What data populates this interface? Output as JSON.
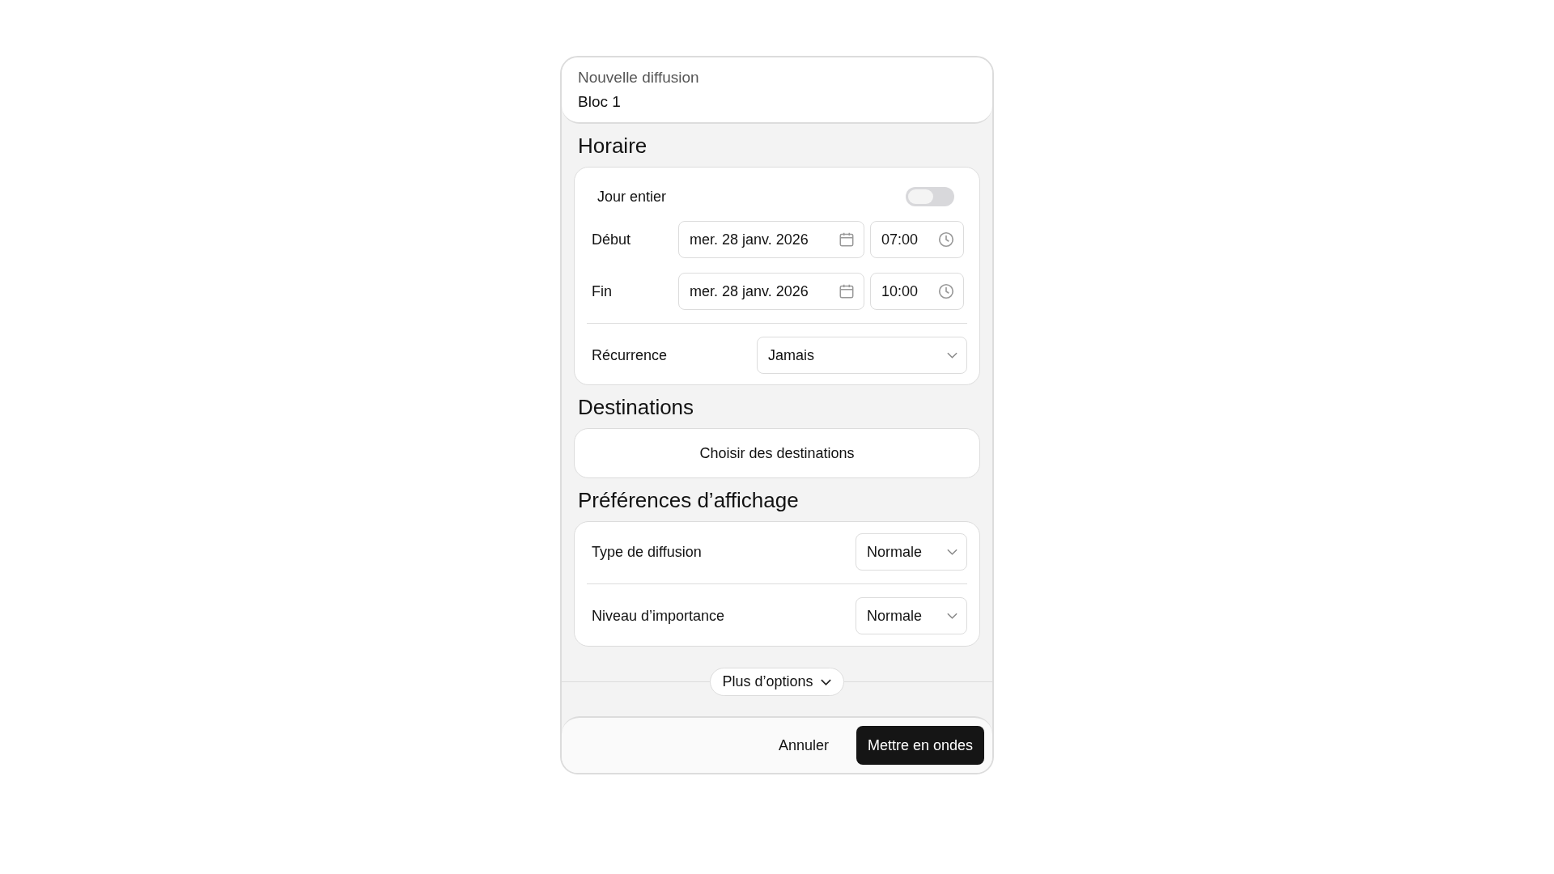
{
  "header": {
    "subtitle": "Nouvelle diffusion",
    "title": "Bloc 1"
  },
  "schedule": {
    "heading": "Horaire",
    "all_day": {
      "label": "Jour entier",
      "on": false
    },
    "ranges": [
      {
        "label": "Début",
        "date": "mer. 28 janv. 2026",
        "time": "07:00"
      },
      {
        "label": "Fin",
        "date": "mer. 28 janv. 2026",
        "time": "10:00"
      }
    ],
    "recurrence": {
      "label": "Récurrence",
      "value": "Jamais"
    }
  },
  "destinations": {
    "heading": "Destinations",
    "button": "Choisir des destinations"
  },
  "display": {
    "heading": "Préférences d’affichage",
    "rows": [
      {
        "label": "Type de diffusion",
        "value": "Normale"
      },
      {
        "label": "Niveau d’importance",
        "value": "Normale"
      }
    ]
  },
  "more_options": {
    "label": "Plus d’options",
    "expanded": false
  },
  "footer": {
    "buttons": [
      {
        "label": "Annuler",
        "kind": "secondary"
      },
      {
        "label": "Mettre en ondes",
        "kind": "primary"
      }
    ]
  }
}
